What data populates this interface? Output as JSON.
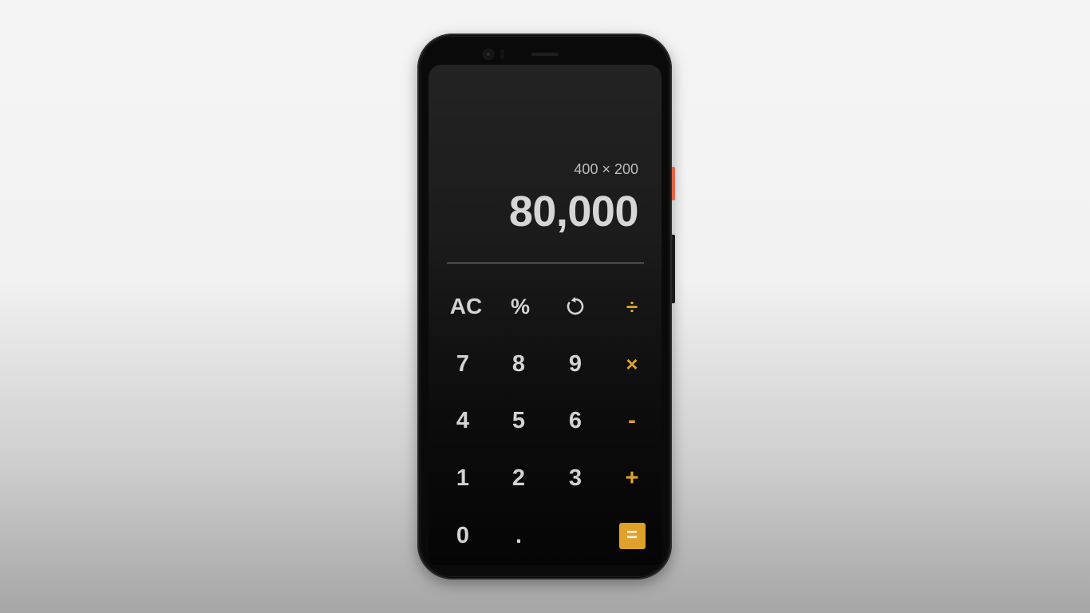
{
  "display": {
    "expression": "400 × 200",
    "result": "80,000"
  },
  "keypad": {
    "row1": {
      "clear": "AC",
      "percent": "%",
      "undo_icon": "undo-icon",
      "divide": "÷"
    },
    "row2": {
      "seven": "7",
      "eight": "8",
      "nine": "9",
      "multiply": "×"
    },
    "row3": {
      "four": "4",
      "five": "5",
      "six": "6",
      "subtract": "-"
    },
    "row4": {
      "one": "1",
      "two": "2",
      "three": "3",
      "add": "+"
    },
    "row5": {
      "zero": "0",
      "decimal": ".",
      "equals": "="
    }
  },
  "colors": {
    "accent": "#e0a12a",
    "key_text": "#d3d3d3",
    "result_text": "#d6d6d6",
    "power_button": "#e0664a"
  }
}
